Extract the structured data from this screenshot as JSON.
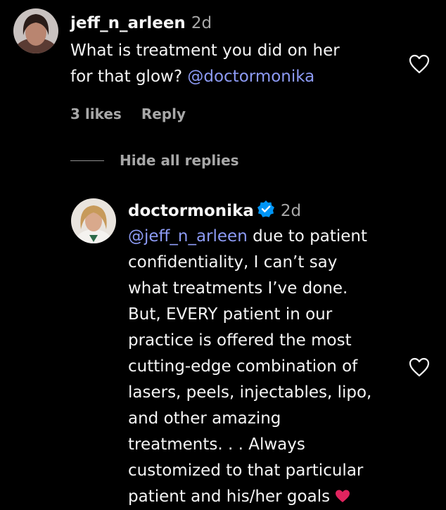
{
  "comment": {
    "username": "jeff_n_arleen",
    "time": "2d",
    "text_line1": "What is treatment you did on her",
    "text_line2_prefix": "for that glow? ",
    "mention": "@doctormonika",
    "likes": "3 likes",
    "reply_label": "Reply"
  },
  "replies_toggle": {
    "label": "Hide all replies"
  },
  "reply": {
    "username": "doctormonika",
    "verified": true,
    "time": "2d",
    "mention": "@jeff_n_arleen",
    "lines": [
      " due to patient",
      "confidentiality, I can’t say",
      "what treatments I’ve done.",
      "But, EVERY patient in our",
      "practice is offered the most",
      "cutting-edge combination of",
      "lasers, peels, injectables, lipo,",
      "and other amazing",
      "treatments. . . Always",
      "customized to that particular",
      "patient and his/her goals"
    ]
  },
  "colors": {
    "background": "#000000",
    "text": "#f5f5f5",
    "secondary": "#a8a8a8",
    "mention": "#8d9bf5",
    "verified": "#0095f6",
    "emoji_heart": "#e0245e"
  },
  "icons": {
    "like": "heart-outline-icon",
    "verified": "verified-badge-icon"
  }
}
